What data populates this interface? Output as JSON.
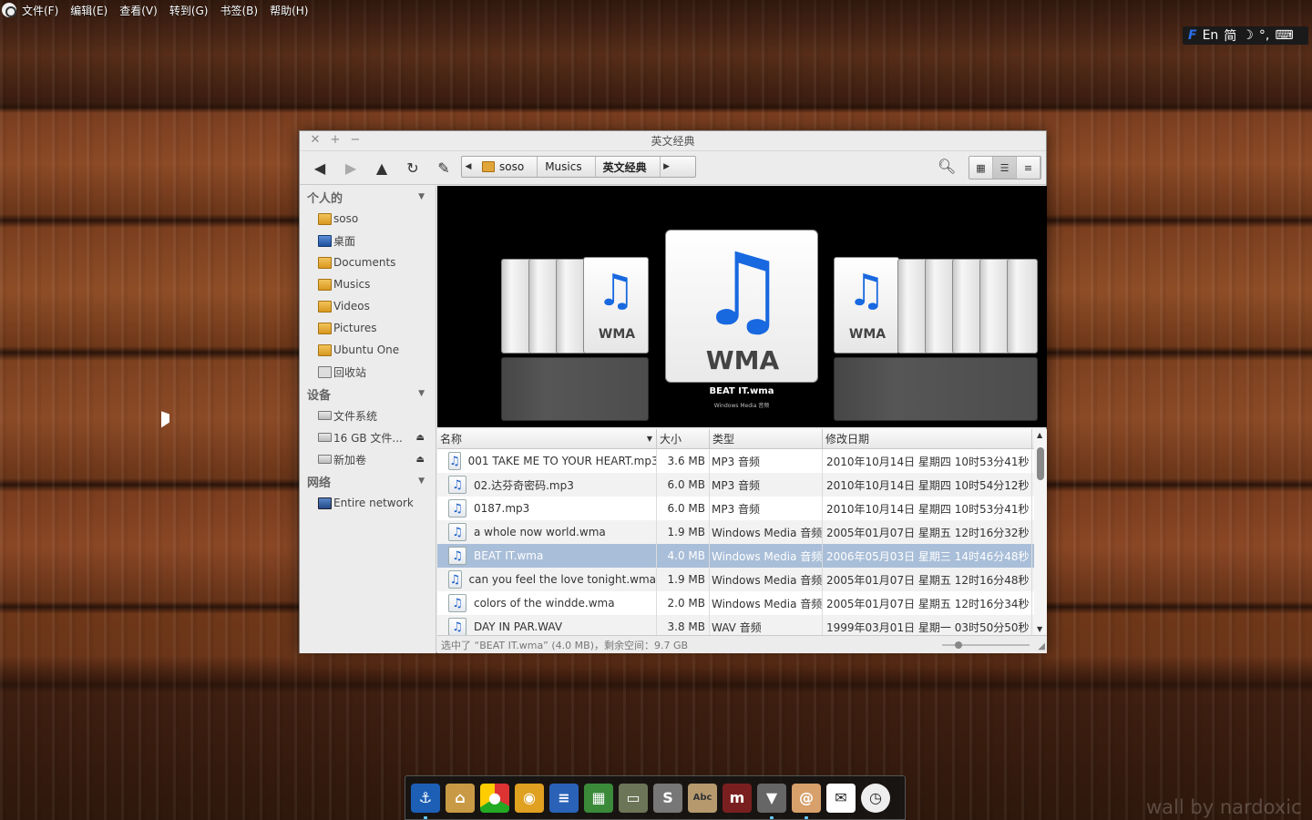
{
  "menubar": {
    "items": [
      "文件(F)",
      "编辑(E)",
      "查看(V)",
      "转到(G)",
      "书签(B)",
      "帮助(H)"
    ]
  },
  "tray": {
    "ime": "En",
    "mode": "简"
  },
  "window": {
    "title": "英文经典",
    "breadcrumbs": [
      "soso",
      "Musics",
      "英文经典"
    ],
    "sidebar": {
      "sections": [
        {
          "label": "个人的",
          "items": [
            "soso",
            "桌面",
            "Documents",
            "Musics",
            "Videos",
            "Pictures",
            "Ubuntu One",
            "回收站"
          ]
        },
        {
          "label": "设备",
          "items": [
            "文件系统",
            "16 GB 文件...",
            "新加卷"
          ]
        },
        {
          "label": "网络",
          "items": [
            "Entire network"
          ]
        }
      ]
    },
    "coverflow": {
      "badge": "WMA",
      "caption": "BEAT IT.wma",
      "subcaption": "Windows Media 音频"
    },
    "columns": [
      "名称",
      "大小",
      "类型",
      "修改日期"
    ],
    "rows": [
      {
        "name": "001 TAKE ME TO YOUR HEART.mp3",
        "size": "3.6 MB",
        "type": "MP3 音频",
        "date": "2010年10月14日 星期四 10时53分41秒"
      },
      {
        "name": "02.达芬奇密码.mp3",
        "size": "6.0 MB",
        "type": "MP3 音频",
        "date": "2010年10月14日 星期四 10时54分12秒"
      },
      {
        "name": "0187.mp3",
        "size": "6.0 MB",
        "type": "MP3 音频",
        "date": "2010年10月14日 星期四 10时53分41秒"
      },
      {
        "name": "a whole now world.wma",
        "size": "1.9 MB",
        "type": "Windows Media 音频",
        "date": "2005年01月07日 星期五 12时16分32秒"
      },
      {
        "name": "BEAT IT.wma",
        "size": "4.0 MB",
        "type": "Windows Media 音频",
        "date": "2006年05月03日 星期三 14时46分48秒"
      },
      {
        "name": "can you feel the love tonight.wma",
        "size": "1.9 MB",
        "type": "Windows Media 音频",
        "date": "2005年01月07日 星期五 12时16分48秒"
      },
      {
        "name": "colors of the windde.wma",
        "size": "2.0 MB",
        "type": "Windows Media 音频",
        "date": "2005年01月07日 星期五 12时16分34秒"
      },
      {
        "name": "DAY IN PAR.WAV",
        "size": "3.8 MB",
        "type": "WAV 音频",
        "date": "1999年03月01日 星期一 03时50分50秒"
      }
    ],
    "selected_row": 4,
    "status": "选中了 “BEAT IT.wma” (4.0 MB)，剩余空间：9.7 GB"
  },
  "dock": {
    "icons": [
      "anchor-icon",
      "home-folder-icon",
      "chrome-icon",
      "eye-icon",
      "writer-icon",
      "calc-icon",
      "terminal-icon",
      "s-app-icon",
      "dictionary-icon",
      "m-app-icon",
      "tie-icon",
      "shell-icon",
      "mail-icon",
      "clock-icon"
    ]
  },
  "watermark": "wall by nardoxic"
}
